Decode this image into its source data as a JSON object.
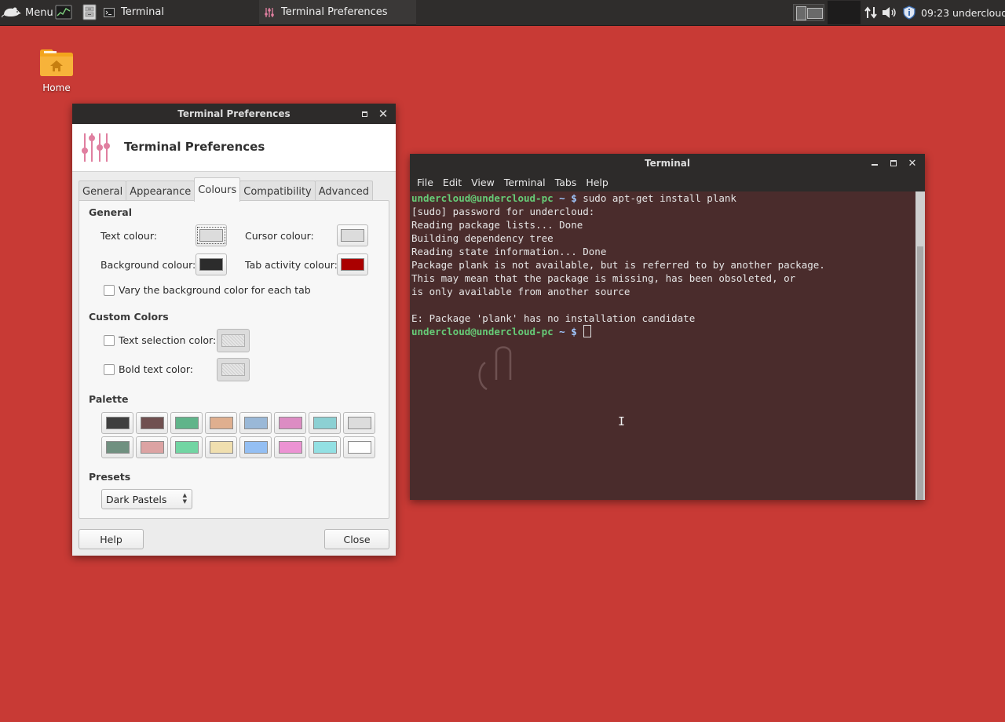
{
  "panel": {
    "menu_label": "Menu",
    "tasks": [
      {
        "label": "Terminal"
      },
      {
        "label": "Terminal Preferences"
      }
    ],
    "clock": "09:23",
    "user": "undercloud"
  },
  "desktop": {
    "icons": [
      {
        "label": "Home"
      }
    ]
  },
  "prefs": {
    "window_title": "Terminal Preferences",
    "header_title": "Terminal Preferences",
    "tabs": [
      "General",
      "Appearance",
      "Colours",
      "Compatibility",
      "Advanced"
    ],
    "active_tab": "Colours",
    "general_section": "General",
    "text_colour_label": "Text colour:",
    "cursor_colour_label": "Cursor colour:",
    "background_colour_label": "Background colour:",
    "tab_activity_colour_label": "Tab activity colour:",
    "vary_bg_label": "Vary the background color for each tab",
    "custom_section": "Custom Colors",
    "text_selection_label": "Text selection color:",
    "bold_text_label": "Bold text color:",
    "palette_section": "Palette",
    "presets_section": "Presets",
    "preset_value": "Dark Pastels",
    "help_button": "Help",
    "close_button": "Close",
    "colors": {
      "text": "#dcdcdc",
      "cursor": "#dcdcdc",
      "background": "#2c2c2c",
      "tab_activity": "#aa0000"
    },
    "palette": [
      [
        "#3f3f3f",
        "#705050",
        "#60b48a",
        "#dfaf8f",
        "#9ab8d7",
        "#dc8cc3",
        "#8cd0d3",
        "#dcdcdc"
      ],
      [
        "#709080",
        "#dca3a3",
        "#72d5a3",
        "#f0dfaf",
        "#94bff3",
        "#ec93d3",
        "#93e0e3",
        "#ffffff"
      ]
    ]
  },
  "terminal": {
    "window_title": "Terminal",
    "menu": [
      "File",
      "Edit",
      "View",
      "Terminal",
      "Tabs",
      "Help"
    ],
    "prompt_user": "undercloud@undercloud-pc",
    "prompt_path": " ~ ",
    "prompt_symbol": "$",
    "command": " sudo apt-get install plank",
    "output": [
      "[sudo] password for undercloud:",
      "Reading package lists... Done",
      "Building dependency tree",
      "Reading state information... Done",
      "Package plank is not available, but is referred to by another package.",
      "This may mean that the package is missing, has been obsoleted, or",
      "is only available from another source",
      "",
      "E: Package 'plank' has no installation candidate"
    ]
  }
}
